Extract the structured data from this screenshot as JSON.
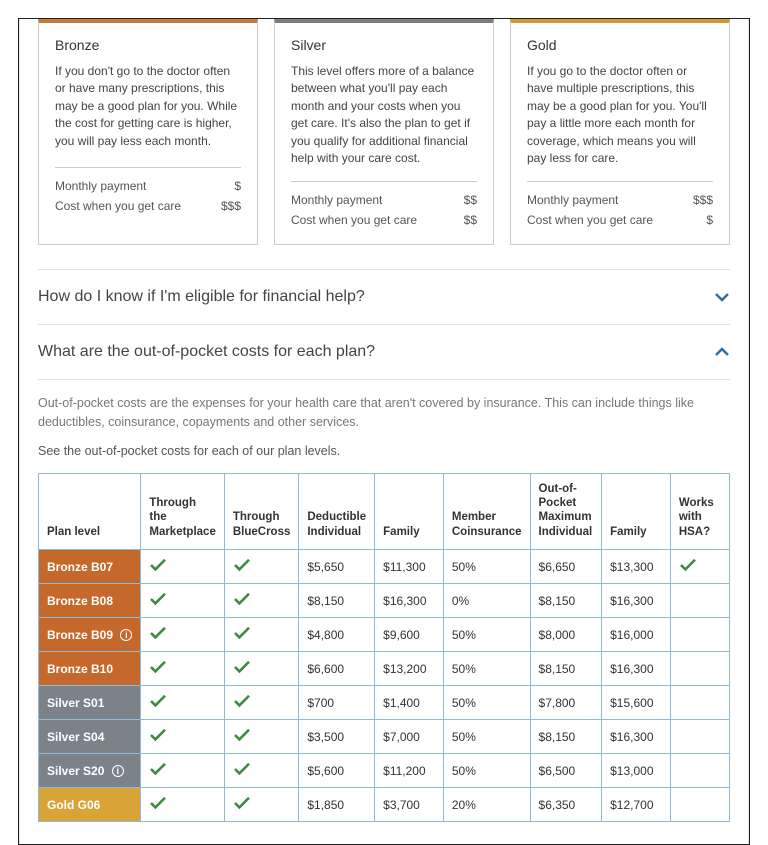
{
  "tiers": {
    "bronze": {
      "name": "Bronze",
      "desc": "If you don't go to the doctor often or have many prescriptions, this may be a good plan for you. While the cost for getting care is higher, you will pay less each month.",
      "monthly_label": "Monthly payment",
      "monthly_value": "$",
      "care_label": "Cost when you get care",
      "care_value": "$$$"
    },
    "silver": {
      "name": "Silver",
      "desc": "This level offers more of a balance between what you'll pay each month and your costs when you get care. It's also the plan to get if you qualify for additional financial help with your care cost.",
      "monthly_label": "Monthly payment",
      "monthly_value": "$$",
      "care_label": "Cost when you get care",
      "care_value": "$$"
    },
    "gold": {
      "name": "Gold",
      "desc": "If you go to the doctor often or have multiple prescriptions, this may be a good plan for you. You'll pay a little more each month for coverage, which means you will pay less for care.",
      "monthly_label": "Monthly payment",
      "monthly_value": "$$$",
      "care_label": "Cost when you get care",
      "care_value": "$"
    }
  },
  "accordion": {
    "q1": "How do I know if I'm eligible for financial help?",
    "q2": "What are the out-of-pocket costs for each plan?",
    "body": {
      "p1": "Out-of-pocket costs are the expenses for your health care that aren't covered by insurance. This can include things like deductibles, coinsurance, copayments and other services.",
      "p2": "See the out-of-pocket costs for each of our plan levels."
    }
  },
  "table": {
    "headers": {
      "plan_level": "Plan level",
      "marketplace": "Through the Marketplace",
      "bluecross": "Through BlueCross",
      "deduct_ind": "Deductible Individual",
      "deduct_fam": "Family",
      "coinsurance": "Member Coinsurance",
      "oop_label": "Out-of-Pocket Maximum Individual",
      "oop_fam": "Family",
      "hsa": "Works with HSA?"
    },
    "rows": [
      {
        "tier": "bronze",
        "name": "Bronze B07",
        "info": false,
        "mkt": true,
        "bc": true,
        "d_ind": "$5,650",
        "d_fam": "$11,300",
        "coin": "50%",
        "o_ind": "$6,650",
        "o_fam": "$13,300",
        "hsa": true
      },
      {
        "tier": "bronze",
        "name": "Bronze B08",
        "info": false,
        "mkt": true,
        "bc": true,
        "d_ind": "$8,150",
        "d_fam": "$16,300",
        "coin": "0%",
        "o_ind": "$8,150",
        "o_fam": "$16,300",
        "hsa": false
      },
      {
        "tier": "bronze",
        "name": "Bronze B09",
        "info": true,
        "mkt": true,
        "bc": true,
        "d_ind": "$4,800",
        "d_fam": "$9,600",
        "coin": "50%",
        "o_ind": "$8,000",
        "o_fam": "$16,000",
        "hsa": false
      },
      {
        "tier": "bronze",
        "name": "Bronze B10",
        "info": false,
        "mkt": true,
        "bc": true,
        "d_ind": "$6,600",
        "d_fam": "$13,200",
        "coin": "50%",
        "o_ind": "$8,150",
        "o_fam": "$16,300",
        "hsa": false
      },
      {
        "tier": "silver",
        "name": "Silver S01",
        "info": false,
        "mkt": true,
        "bc": true,
        "d_ind": "$700",
        "d_fam": "$1,400",
        "coin": "50%",
        "o_ind": "$7,800",
        "o_fam": "$15,600",
        "hsa": false
      },
      {
        "tier": "silver",
        "name": "Silver S04",
        "info": false,
        "mkt": true,
        "bc": true,
        "d_ind": "$3,500",
        "d_fam": "$7,000",
        "coin": "50%",
        "o_ind": "$8,150",
        "o_fam": "$16,300",
        "hsa": false
      },
      {
        "tier": "silver",
        "name": "Silver S20",
        "info": true,
        "mkt": true,
        "bc": true,
        "d_ind": "$5,600",
        "d_fam": "$11,200",
        "coin": "50%",
        "o_ind": "$6,500",
        "o_fam": "$13,000",
        "hsa": false
      },
      {
        "tier": "gold",
        "name": "Gold G06",
        "info": false,
        "mkt": true,
        "bc": true,
        "d_ind": "$1,850",
        "d_fam": "$3,700",
        "coin": "20%",
        "o_ind": "$6,350",
        "o_fam": "$12,700",
        "hsa": false
      }
    ]
  }
}
